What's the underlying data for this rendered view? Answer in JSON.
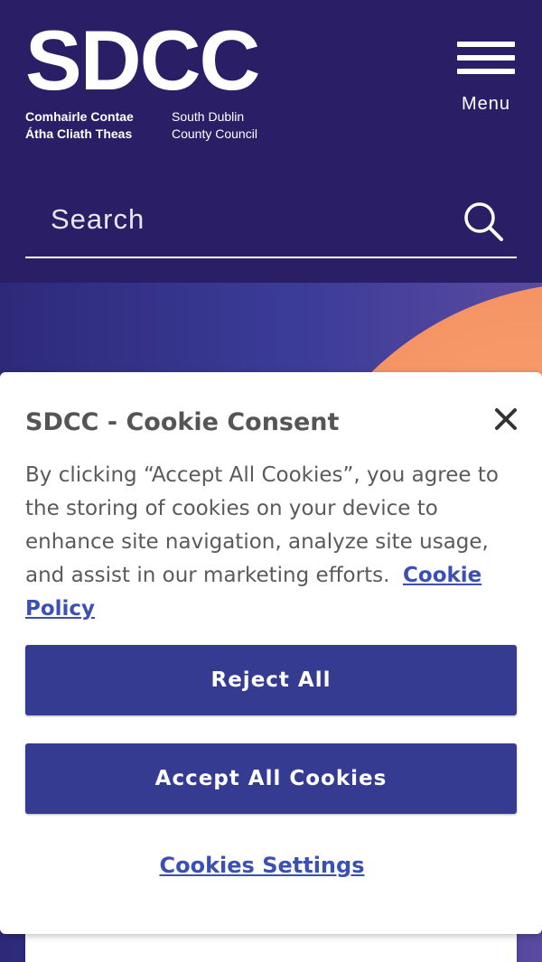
{
  "header": {
    "logo_text": "SDCC",
    "logo_sub_irish": [
      "Comhairle Contae",
      "Átha Cliath Theas"
    ],
    "logo_sub_english": [
      "South Dublin",
      "County Council"
    ],
    "menu_label": "Menu",
    "menu_icon": "hamburger-icon"
  },
  "search": {
    "placeholder": "Search",
    "value": "",
    "icon": "search-icon"
  },
  "cookie_dialog": {
    "title": "SDCC - Cookie Consent",
    "body_text": "By clicking “Accept All Cookies”, you agree to the storing of cookies on your device to enhance site navigation, analyze site usage, and assist in our marketing efforts.",
    "policy_link": "Cookie Policy",
    "reject_label": "Reject All",
    "accept_label": "Accept All Cookies",
    "settings_label": "Cookies Settings",
    "close_icon": "close-icon"
  },
  "colors": {
    "header_bg": "#2a1f66",
    "button_bg": "#343b90",
    "link": "#3b4fb5",
    "hero_accent": "#f49165"
  }
}
